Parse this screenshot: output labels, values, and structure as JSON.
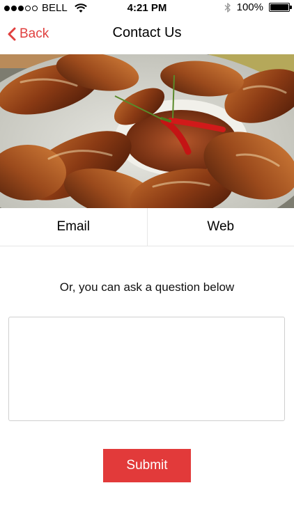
{
  "status_bar": {
    "carrier": "BELL",
    "time": "4:21 PM",
    "battery_text": "100%",
    "signal_bars_filled": 3,
    "signal_bars_total": 5
  },
  "nav": {
    "back_label": "Back",
    "title": "Contact Us"
  },
  "tabs": [
    {
      "label": "Email"
    },
    {
      "label": "Web"
    }
  ],
  "form": {
    "prompt": "Or, you can ask a question below",
    "question_value": "",
    "question_placeholder": "",
    "submit_label": "Submit"
  },
  "colors": {
    "accent": "#e0403f",
    "submit_bg": "#e23a3a",
    "divider": "#e6e6e6"
  },
  "icons": {
    "back": "chevron-left-icon",
    "wifi": "wifi-icon",
    "bluetooth": "bluetooth-icon",
    "battery": "battery-icon",
    "hero": "chicken-wings-photo"
  }
}
